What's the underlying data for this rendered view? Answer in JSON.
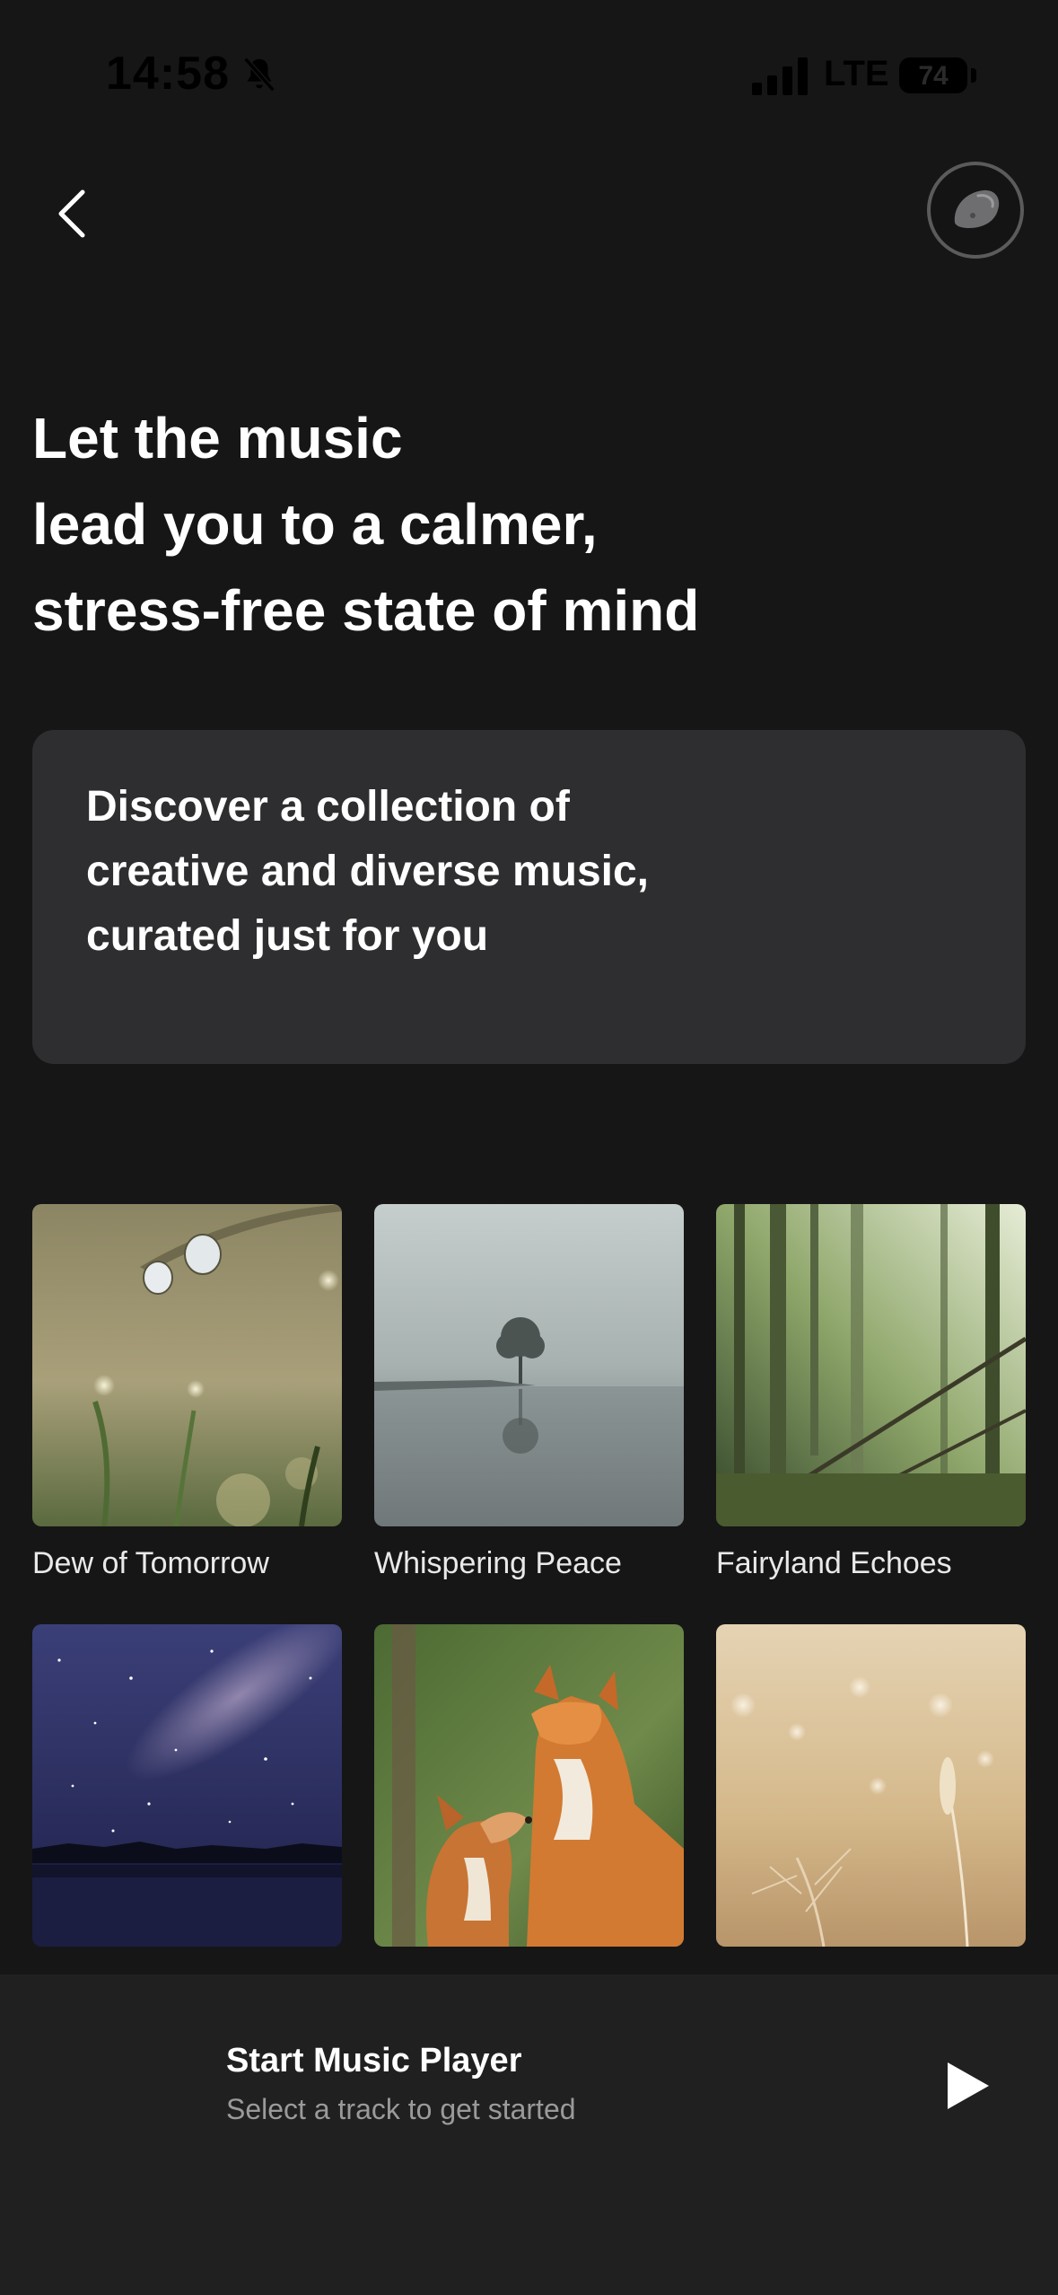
{
  "status_bar": {
    "time": "14:58",
    "network": "LTE",
    "battery_level": "74",
    "icons": [
      "bell-slash-icon",
      "signal-icon"
    ]
  },
  "nav": {
    "back_icon": "chevron-left-icon",
    "avatar_icon": "avatar-icon"
  },
  "headline": {
    "lines": [
      "Let the music",
      "lead you to a calmer,",
      "stress-free state of mind"
    ]
  },
  "promo": {
    "lines": [
      "Discover a collection of",
      "creative and diverse music,",
      "curated just for you"
    ]
  },
  "tracks": [
    {
      "title": "Dew of Tomorrow",
      "image": "dew-drops-image"
    },
    {
      "title": "Whispering Peace",
      "image": "misty-lake-tree-image"
    },
    {
      "title": "Fairyland Echoes",
      "image": "forest-image"
    },
    {
      "title": "",
      "image": "starry-night-lake-image"
    },
    {
      "title": "",
      "image": "foxes-image"
    },
    {
      "title": "",
      "image": "golden-grass-image"
    }
  ],
  "player": {
    "title": "Start Music Player",
    "subtitle": "Select a track to get started",
    "play_icon": "play-icon"
  },
  "colors": {
    "background": "#161617",
    "card": "#2e2e30",
    "player_bar": "#202021",
    "secondary_text": "#9a9a9c"
  }
}
